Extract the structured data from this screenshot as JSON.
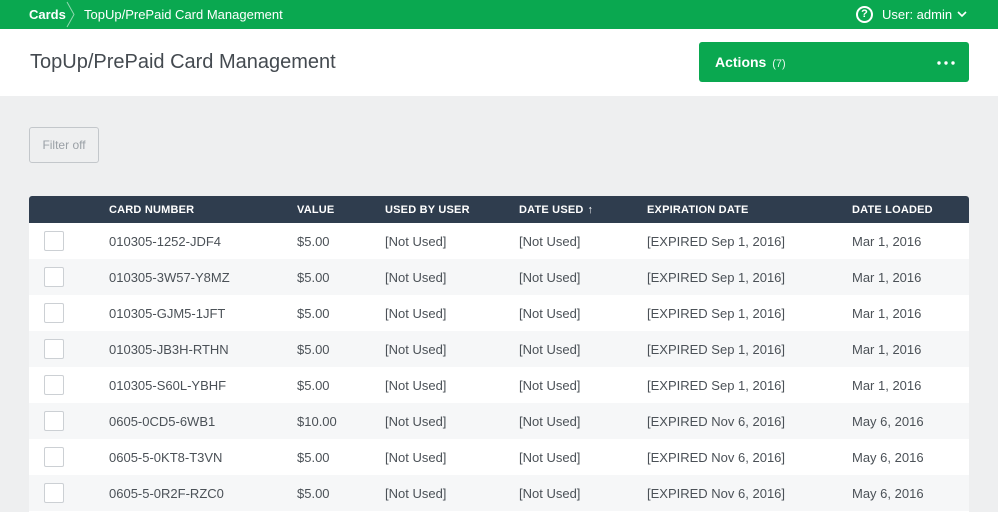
{
  "breadcrumb": {
    "root": "Cards",
    "current": "TopUp/PrePaid Card Management"
  },
  "user_menu": {
    "label": "User: admin",
    "icon": "help-circle-icon"
  },
  "header": {
    "title": "TopUp/PrePaid Card Management",
    "actions_label": "Actions",
    "actions_count": "(7)"
  },
  "filter": {
    "label": "Filter off"
  },
  "colors": {
    "brand": "#0aa850",
    "table_header": "#2f3d4e"
  },
  "table": {
    "columns": [
      "CARD NUMBER",
      "VALUE",
      "USED BY USER",
      "DATE USED",
      "EXPIRATION DATE",
      "DATE LOADED"
    ],
    "sort": {
      "column": "DATE USED",
      "direction": "ascending"
    },
    "rows": [
      [
        "010305-1252-JDF4",
        "$5.00",
        "[Not Used]",
        "[Not Used]",
        "[EXPIRED Sep 1, 2016]",
        "Mar 1, 2016"
      ],
      [
        "010305-3W57-Y8MZ",
        "$5.00",
        "[Not Used]",
        "[Not Used]",
        "[EXPIRED Sep 1, 2016]",
        "Mar 1, 2016"
      ],
      [
        "010305-GJM5-1JFT",
        "$5.00",
        "[Not Used]",
        "[Not Used]",
        "[EXPIRED Sep 1, 2016]",
        "Mar 1, 2016"
      ],
      [
        "010305-JB3H-RTHN",
        "$5.00",
        "[Not Used]",
        "[Not Used]",
        "[EXPIRED Sep 1, 2016]",
        "Mar 1, 2016"
      ],
      [
        "010305-S60L-YBHF",
        "$5.00",
        "[Not Used]",
        "[Not Used]",
        "[EXPIRED Sep 1, 2016]",
        "Mar 1, 2016"
      ],
      [
        "0605-0CD5-6WB1",
        "$10.00",
        "[Not Used]",
        "[Not Used]",
        "[EXPIRED Nov 6, 2016]",
        "May 6, 2016"
      ],
      [
        "0605-5-0KT8-T3VN",
        "$5.00",
        "[Not Used]",
        "[Not Used]",
        "[EXPIRED Nov 6, 2016]",
        "May 6, 2016"
      ],
      [
        "0605-5-0R2F-RZC0",
        "$5.00",
        "[Not Used]",
        "[Not Used]",
        "[EXPIRED Nov 6, 2016]",
        "May 6, 2016"
      ]
    ]
  }
}
